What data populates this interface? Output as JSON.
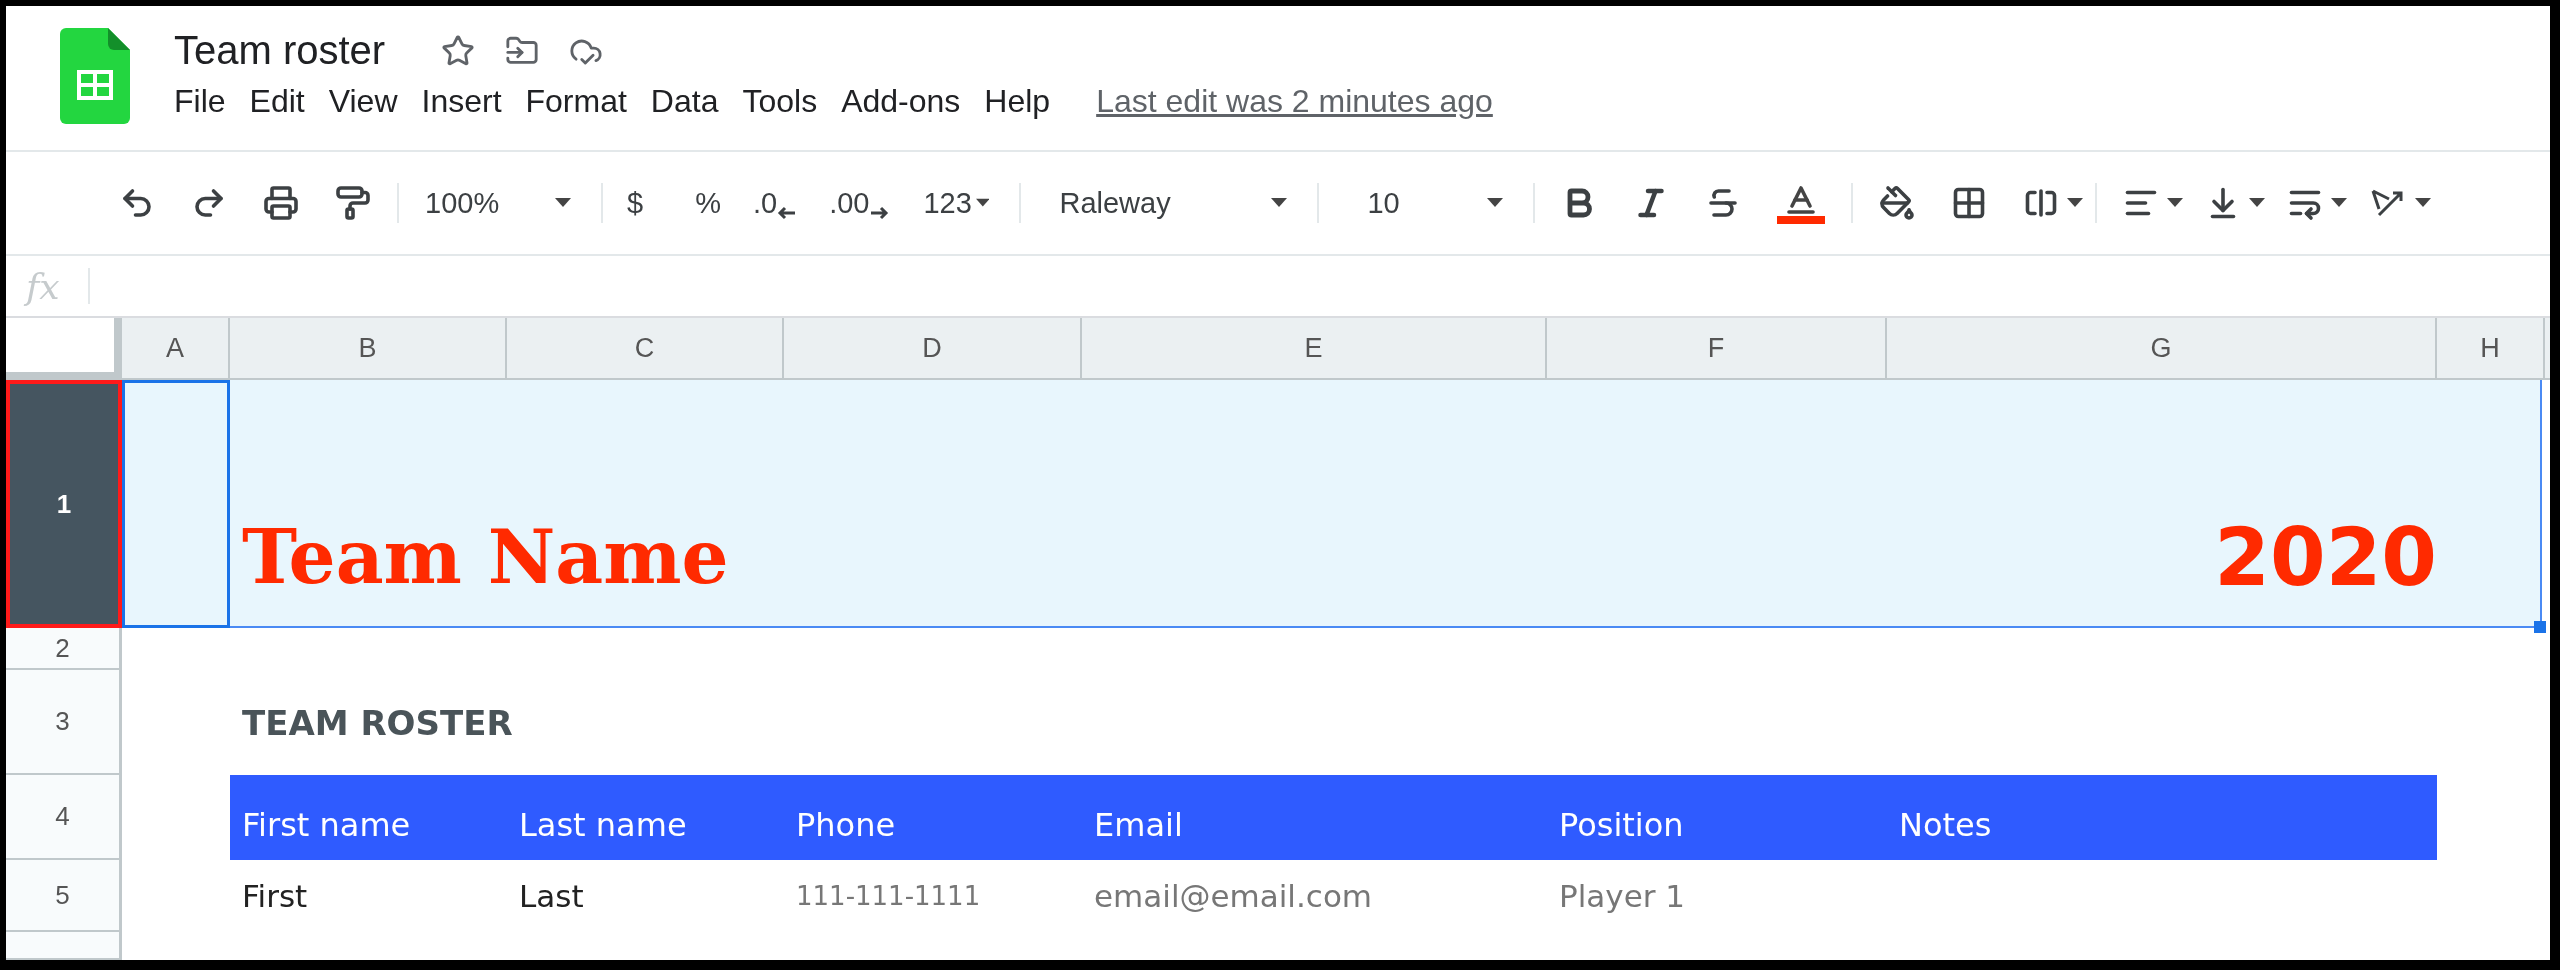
{
  "app": {
    "title": "Team roster",
    "menu": [
      "File",
      "Edit",
      "View",
      "Insert",
      "Format",
      "Data",
      "Tools",
      "Add-ons",
      "Help"
    ],
    "last_edit": "Last edit was 2 minutes ago"
  },
  "toolbar": {
    "zoom": "100%",
    "currency": "$",
    "percent": "%",
    "decrease_decimals": ".0",
    "increase_decimals": ".00",
    "number_format": "123",
    "font": "Raleway",
    "font_size": "10"
  },
  "formula_bar": {
    "label": "fx"
  },
  "sheet": {
    "columns": [
      {
        "label": "A",
        "selected": false
      },
      {
        "label": "B",
        "selected": false
      },
      {
        "label": "C",
        "selected": false
      },
      {
        "label": "D",
        "selected": false
      },
      {
        "label": "E",
        "selected": false
      },
      {
        "label": "F",
        "selected": false
      },
      {
        "label": "G",
        "selected": false
      },
      {
        "label": "H",
        "selected": false
      }
    ],
    "rows": [
      {
        "label": "1",
        "selected": true
      },
      {
        "label": "2",
        "selected": false
      },
      {
        "label": "3",
        "selected": false
      },
      {
        "label": "4",
        "selected": false
      },
      {
        "label": "5",
        "selected": false
      }
    ],
    "team_name": "Team Name",
    "year": "2020",
    "heading": "TEAM ROSTER",
    "table": {
      "columns": [
        "First name",
        "Last name",
        "Phone",
        "Email",
        "Position",
        "Notes"
      ],
      "rows": [
        [
          "First",
          "Last",
          "111-111-1111",
          "email@email.com",
          "Player 1",
          ""
        ]
      ]
    }
  }
}
